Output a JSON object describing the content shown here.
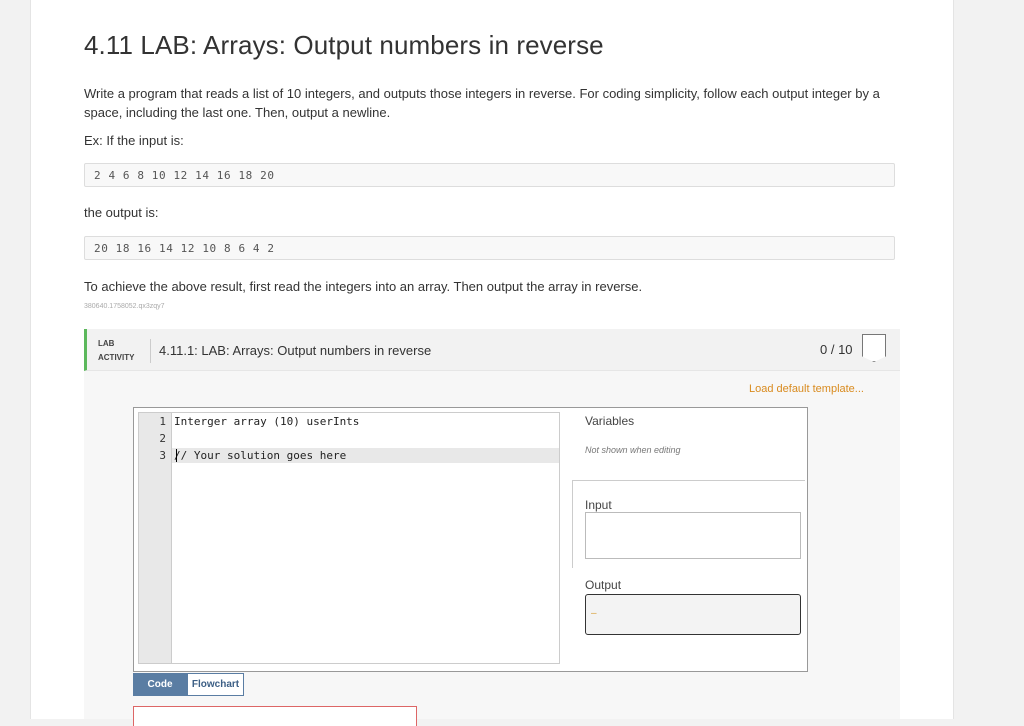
{
  "title": "4.11 LAB: Arrays: Output numbers in reverse",
  "description": "Write a program that reads a list of 10 integers, and outputs those integers in reverse. For coding simplicity, follow each output integer by a space, including the last one. Then, output a newline.",
  "example_label": "Ex: If the input is:",
  "example_input": "2 4 6 8 10 12 14 16 18 20",
  "output_label": "the output is:",
  "example_output": "20 18 16 14 12 10 8 6 4 2",
  "instructions": "To achieve the above result, first read the integers into an array. Then output the array in reverse.",
  "small_id": "380640.1758052.qx3zqy7",
  "lab": {
    "tag_line1": "LAB",
    "tag_line2": "ACTIVITY",
    "name": "4.11.1: LAB: Arrays: Output numbers in reverse",
    "score": "0 / 10",
    "load_template": "Load default template...",
    "editor_lines": [
      {
        "num": "1",
        "text": "Interger array (10) userInts"
      },
      {
        "num": "2",
        "text": ""
      },
      {
        "num": "3",
        "text": "// Your solution goes here"
      }
    ],
    "variables_label": "Variables",
    "variables_note": "Not shown when editing",
    "input_label": "Input",
    "output_label": "Output",
    "tab_code": "Code",
    "tab_flowchart": "Flowchart"
  },
  "colors": {
    "accent_green": "#5cb85c",
    "link_orange": "#d98b1f",
    "tab_blue": "#5a7da3"
  }
}
